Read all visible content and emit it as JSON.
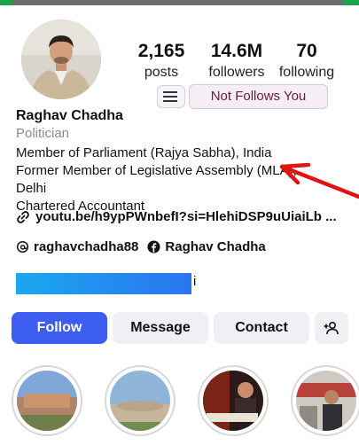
{
  "profile": {
    "name": "Raghav Chadha",
    "category": "Politician",
    "bio": [
      "Member of Parliament (Rajya Sabha), India",
      "Former Member of Legislative Assembly (MLA),",
      "Delhi",
      "Chartered Accountant"
    ],
    "link": "youtu.be/h9ypPWnbefI?si=HlehiDSP9uUiaiLb ...",
    "threads_handle": "raghavchadha88",
    "facebook_name": "Raghav Chadha",
    "redacted_tail": "i"
  },
  "stats": {
    "posts": {
      "value": "2,165",
      "label": "posts"
    },
    "followers": {
      "value": "14.6M",
      "label": "followers"
    },
    "following": {
      "value": "70",
      "label": "following"
    }
  },
  "relation_badge": "Not Follows You",
  "actions": {
    "follow": "Follow",
    "message": "Message",
    "contact": "Contact"
  },
  "icons": {
    "menu": "menu-list-icon",
    "link": "link-icon",
    "threads": "threads-icon",
    "facebook": "facebook-icon",
    "add_person": "add-person-icon"
  },
  "colors": {
    "follow_button": "#3d5df0",
    "annotation_arrow": "#e11414",
    "redaction": "#1e90f0"
  }
}
